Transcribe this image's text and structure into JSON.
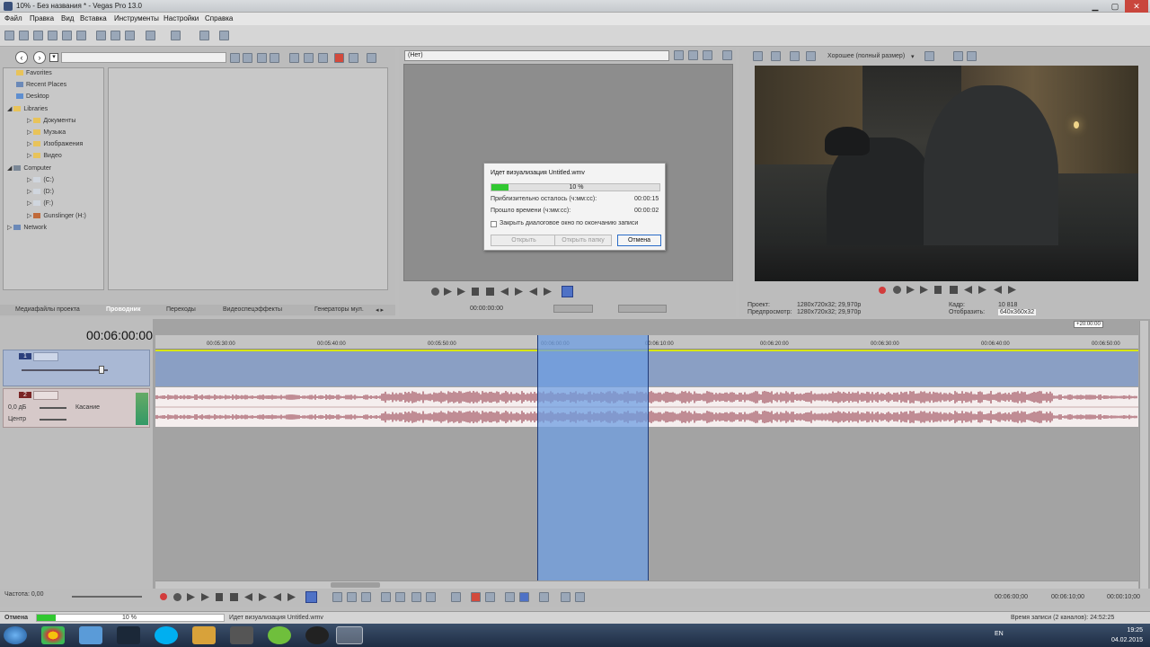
{
  "window": {
    "title": "10% - Без названия * - Vegas Pro 13.0"
  },
  "menu": [
    "Файл",
    "Правка",
    "Вид",
    "Вставка",
    "Инструменты",
    "Настройки",
    "Справка"
  ],
  "explorer": {
    "tree": [
      "Favorites",
      "Recent Places",
      "Desktop",
      "Libraries",
      "Документы",
      "Музыка",
      "Изображения",
      "Видео",
      "Computer",
      "(C:)",
      "(D:)",
      "(F:)",
      "Gunslinger (H:)",
      "Network"
    ],
    "tabs": [
      "Медиафайлы проекта",
      "Проводник",
      "Переходы",
      "Видеоспецэффекты",
      "Генераторы мул."
    ]
  },
  "trimmer": {
    "combo": "(Нет)",
    "timecode": "00:00:00:00"
  },
  "preview": {
    "quality": "Хорошее (полный размер)",
    "project_label": "Проект:",
    "project_value": "1280x720x32; 29,970p",
    "preview_label": "Предпросмотр:",
    "preview_value": "1280x720x32; 29,970p",
    "frame_label": "Кадр:",
    "frame_value": "10 818",
    "display_label": "Отобразить:",
    "display_value": "640x360x32"
  },
  "dialog": {
    "title": "Идет визуализация Untitled.wmv",
    "progress": 0.1,
    "progress_label": "10 %",
    "remaining_label": "Приблизительно осталось (ч:мм:сс):",
    "remaining_value": "00:00:15",
    "elapsed_label": "Прошло времени (ч:мм:сс):",
    "elapsed_value": "00:00:02",
    "close_checkbox": "Закрыть диалоговое окно по окончанию записи",
    "btn_open": "Открыть",
    "btn_open_folder": "Открыть папку",
    "btn_cancel": "Отмена"
  },
  "timeline": {
    "timecode": "00:06:00:00",
    "ruler_marks": [
      "00:05:30:00",
      "00:05:40:00",
      "00:05:50:00",
      "00:06:00:00",
      "00:06:10:00",
      "00:06:20:00",
      "00:06:30:00",
      "00:06:40:00",
      "00:06:50:00"
    ],
    "region_marker": "+20:00:00",
    "video_track_num": "1",
    "audio_track_num": "2",
    "audio_volume": "0,0 дБ",
    "audio_pan": "Центр",
    "audio_mode": "Касание",
    "rate": "Частота: 0,00",
    "sel_start": "00:06:00;00",
    "sel_end": "00:06:10;00",
    "sel_length": "00:00:10;00"
  },
  "status": {
    "cancel": "Отмена",
    "progress": 0.1,
    "progress_label": "10 %",
    "message": "Идет визуализация Untitled.wmv",
    "record_time": "Время записи (2 каналов): 24:52:25"
  },
  "taskbar": {
    "lang": "EN",
    "time": "19:25",
    "date": "04.02.2015"
  }
}
